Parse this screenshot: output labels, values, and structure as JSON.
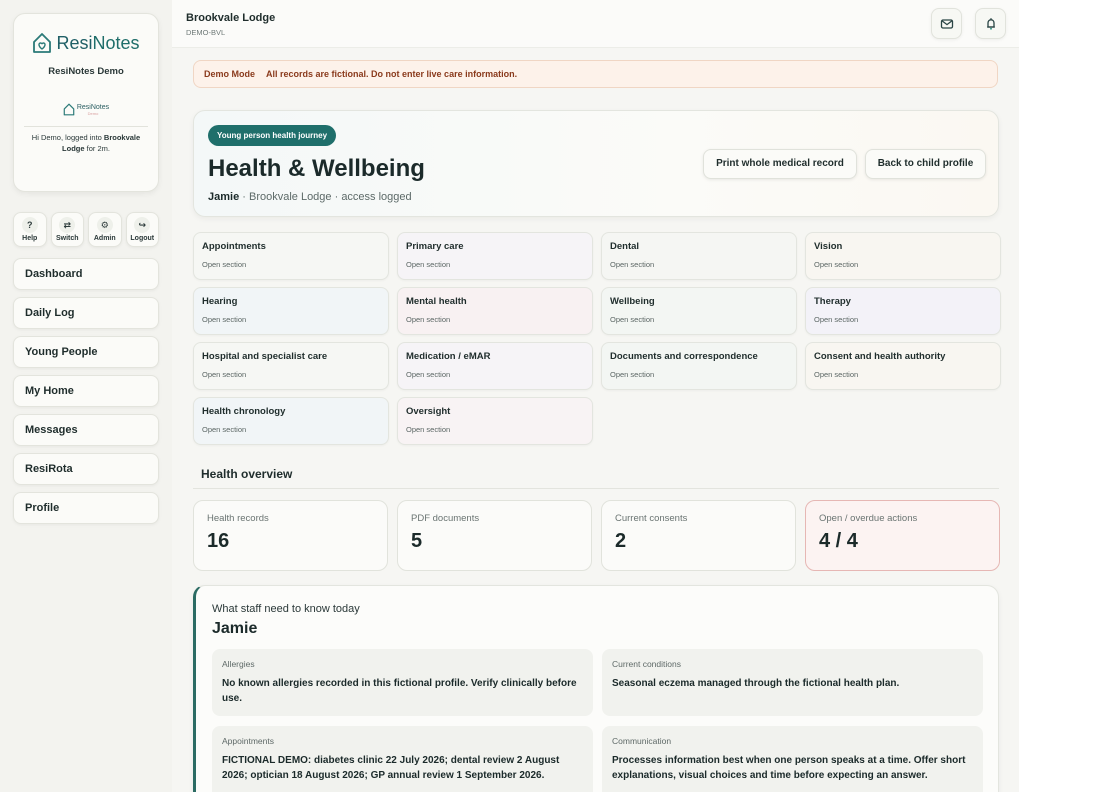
{
  "app": {
    "brand": "ResiNotes",
    "brand_part1": "Resi",
    "brand_part2": "Notes",
    "org_name": "ResiNotes Demo",
    "mini_brand": "ResiNotes",
    "mini_brand_sub": "Demo",
    "login_prefix": "Hi Demo, logged into ",
    "login_home": "Brookvale Lodge",
    "login_suffix": " for 2m."
  },
  "quick_actions": [
    {
      "label": "Help",
      "icon": "help-icon",
      "glyph": "?"
    },
    {
      "label": "Switch",
      "icon": "switch-icon",
      "glyph": "⇄"
    },
    {
      "label": "Admin",
      "icon": "gear-icon",
      "glyph": "⚙"
    },
    {
      "label": "Logout",
      "icon": "logout-icon",
      "glyph": "↪"
    }
  ],
  "nav": [
    "Dashboard",
    "Daily Log",
    "Young People",
    "My Home",
    "Messages",
    "ResiRota",
    "Profile"
  ],
  "header": {
    "home_name": "Brookvale Lodge",
    "home_code": "DEMO-BVL",
    "icons": [
      "mail-icon",
      "bell-icon"
    ]
  },
  "banner": {
    "label": "Demo Mode",
    "text": "All records are fictional. Do not enter live care information."
  },
  "hero": {
    "chip": "Young person health journey",
    "title": "Health & Wellbeing",
    "person": "Jamie",
    "sub": " · Brookvale Lodge · access logged",
    "print_button": "Print whole medical record",
    "back_button": "Back to child profile"
  },
  "sections": [
    {
      "title": "Appointments",
      "open": "Open section",
      "tint": "#f6f7f4"
    },
    {
      "title": "Primary care",
      "open": "Open section",
      "tint": "#f6f4f7"
    },
    {
      "title": "Dental",
      "open": "Open section",
      "tint": "#f5f6f3"
    },
    {
      "title": "Vision",
      "open": "Open section",
      "tint": "#f8f6f1"
    },
    {
      "title": "Hearing",
      "open": "Open section",
      "tint": "#f1f5f7"
    },
    {
      "title": "Mental health",
      "open": "Open section",
      "tint": "#f8f1f2"
    },
    {
      "title": "Wellbeing",
      "open": "Open section",
      "tint": "#f3f6f3"
    },
    {
      "title": "Therapy",
      "open": "Open section",
      "tint": "#f3f2f8"
    },
    {
      "title": "Hospital and specialist care",
      "open": "Open section",
      "tint": "#f6f7f4"
    },
    {
      "title": "Medication / eMAR",
      "open": "Open section",
      "tint": "#f6f4f7"
    },
    {
      "title": "Documents and correspondence",
      "open": "Open section",
      "tint": "#f3f6f3"
    },
    {
      "title": "Consent and health authority",
      "open": "Open section",
      "tint": "#f8f6f1"
    },
    {
      "title": "Health chronology",
      "open": "Open section",
      "tint": "#f1f5f7"
    },
    {
      "title": "Oversight",
      "open": "Open section",
      "tint": "#f8f3f4"
    }
  ],
  "overview": {
    "title": "Health overview",
    "stats": [
      {
        "label": "Health records",
        "value": "16"
      },
      {
        "label": "PDF documents",
        "value": "5"
      },
      {
        "label": "Current consents",
        "value": "2"
      },
      {
        "label": "Open / overdue actions",
        "value": "4 / 4"
      }
    ]
  },
  "staff_know": {
    "label": "What staff need to know today",
    "name": "Jamie",
    "cells": [
      {
        "label": "Allergies",
        "value": "No known allergies recorded in this fictional profile. Verify clinically before use."
      },
      {
        "label": "Current conditions",
        "value": "Seasonal eczema managed through the fictional health plan."
      },
      {
        "label": "Appointments",
        "value": "FICTIONAL DEMO: diabetes clinic 22 July 2026; dental review 2 August 2026; optician 18 August 2026; GP annual review 1 September 2026."
      },
      {
        "label": "Communication",
        "value": "Processes information best when one person speaks at a time. Offer short explanations, visual choices and time before expecting an answer."
      }
    ]
  }
}
